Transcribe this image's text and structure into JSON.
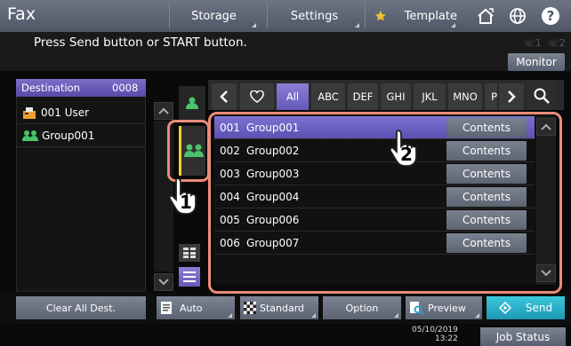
{
  "topbar": {
    "title": "Fax",
    "storage": "Storage",
    "settings": "Settings",
    "template": "Template"
  },
  "message": "Press Send button or START button.",
  "lines": {
    "line1": "1",
    "line2": "2"
  },
  "monitor": "Monitor",
  "destination": {
    "label": "Destination",
    "count": "0008",
    "items": [
      {
        "label": "001 User",
        "icon": "fax-user-icon"
      },
      {
        "label": "Group001",
        "icon": "group-icon"
      }
    ]
  },
  "tabs": [
    "All",
    "ABC",
    "DEF",
    "GHI",
    "JKL",
    "MNO",
    "P"
  ],
  "list": [
    {
      "num": "001",
      "name": "Group001",
      "contents": "Contents",
      "selected": true
    },
    {
      "num": "002",
      "name": "Group002",
      "contents": "Contents",
      "selected": false
    },
    {
      "num": "003",
      "name": "Group003",
      "contents": "Contents",
      "selected": false
    },
    {
      "num": "004",
      "name": "Group004",
      "contents": "Contents",
      "selected": false
    },
    {
      "num": "005",
      "name": "Group006",
      "contents": "Contents",
      "selected": false
    },
    {
      "num": "006",
      "name": "Group007",
      "contents": "Contents",
      "selected": false
    }
  ],
  "bottom": {
    "clear": "Clear All Dest.",
    "auto": "Auto",
    "standard": "Standard",
    "option": "Option",
    "preview": "Preview",
    "send": "Send"
  },
  "status": {
    "date": "05/10/2019",
    "time": "13:22",
    "job_status": "Job Status"
  },
  "callouts": {
    "step1": "1",
    "step2": "2"
  },
  "colors": {
    "accent": "#6558b8",
    "highlight": "#ec8c78",
    "send": "#1d98b4"
  }
}
